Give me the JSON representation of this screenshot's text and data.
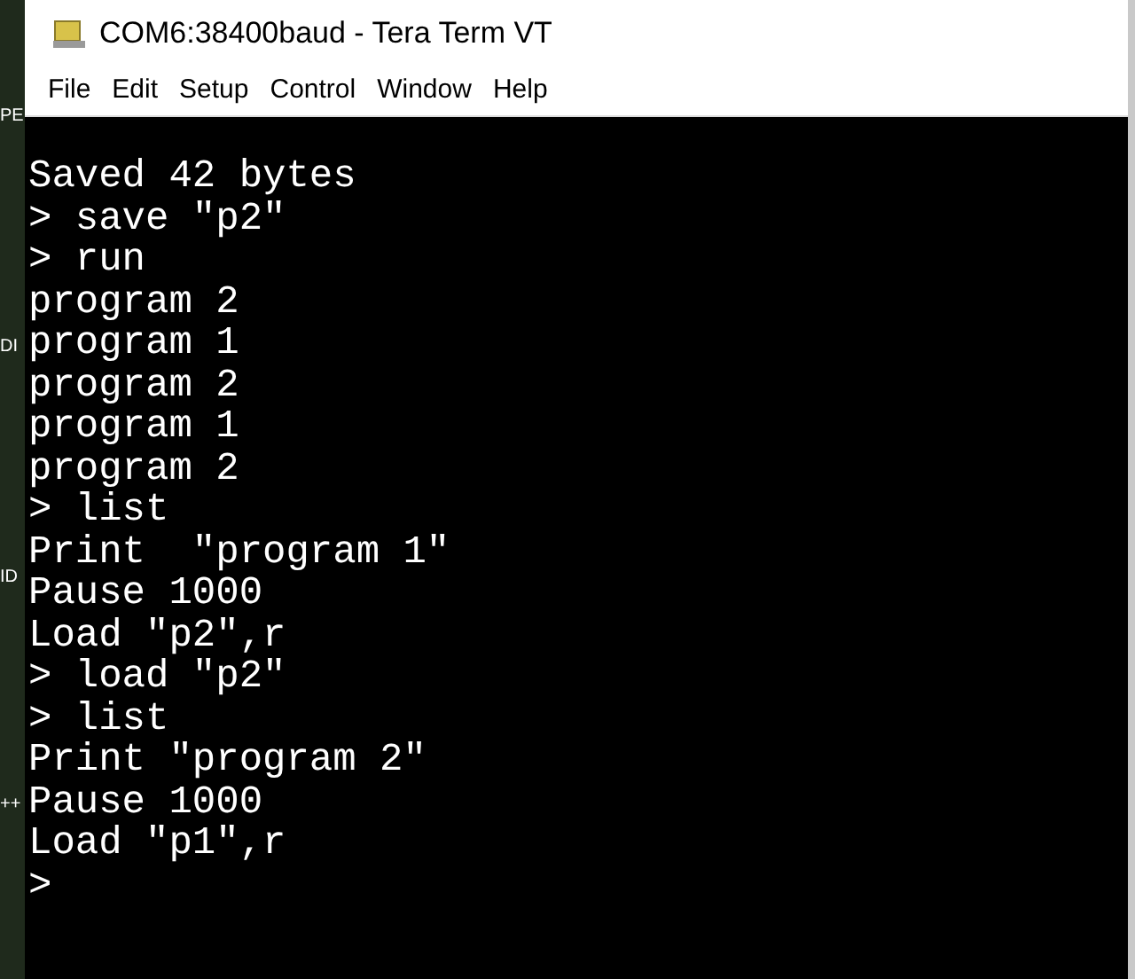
{
  "desktop": {
    "labels": [
      "PE",
      "DI",
      "ID",
      "++"
    ]
  },
  "window": {
    "title": "COM6:38400baud - Tera Term VT"
  },
  "menu": [
    "File",
    "Edit",
    "Setup",
    "Control",
    "Window",
    "Help"
  ],
  "terminal": {
    "lines": [
      "Saved 42 bytes",
      "> save \"p2\"",
      "> run",
      "program 2",
      "program 1",
      "program 2",
      "program 1",
      "program 2",
      "> list",
      "Print  \"program 1\"",
      "Pause 1000",
      "Load \"p2\",r",
      "> load \"p2\"",
      "> list",
      "Print \"program 2\"",
      "Pause 1000",
      "Load \"p1\",r",
      ">"
    ]
  }
}
